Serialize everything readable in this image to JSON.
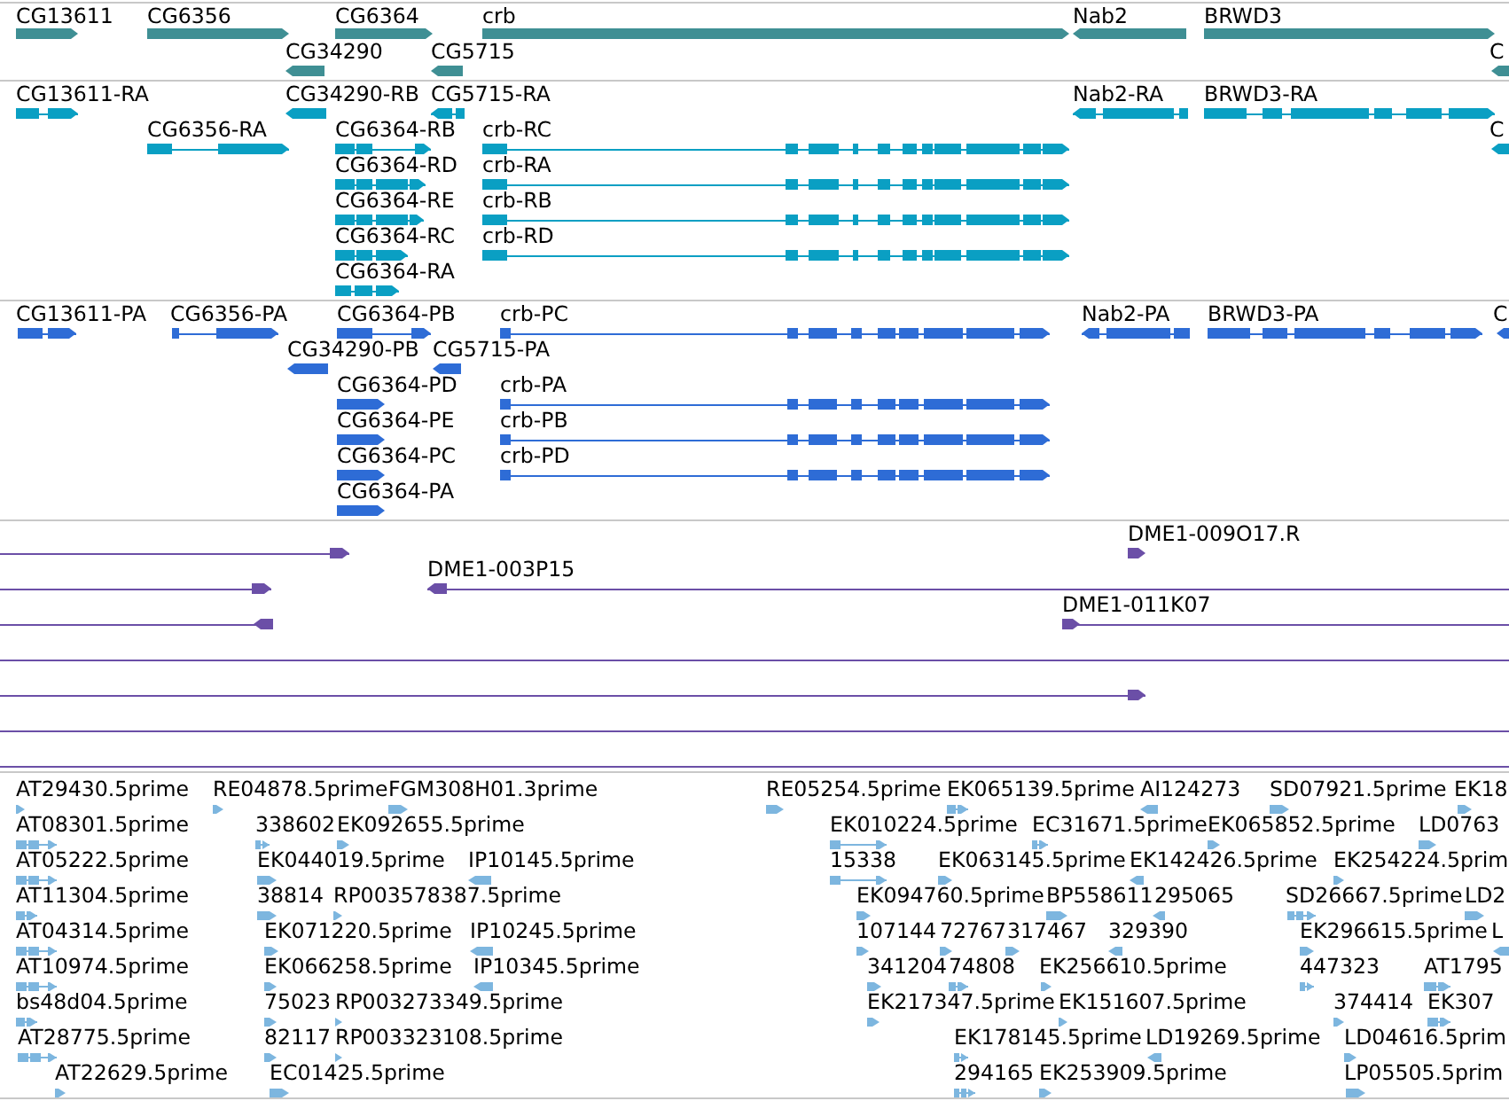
{
  "tracks": [
    {
      "kind": "gene",
      "color": "#3f8f94",
      "features": [
        {
          "label": "CG13611",
          "reverse": false
        },
        {
          "label": "CG6356",
          "reverse": false
        },
        {
          "label": "CG6364",
          "reverse": false
        },
        {
          "label": "crb",
          "reverse": false
        },
        {
          "label": "Nab2",
          "reverse": true
        },
        {
          "label": "BRWD3",
          "reverse": false
        },
        {
          "label": "CG34290",
          "reverse": true
        },
        {
          "label": "CG5715",
          "reverse": true
        },
        {
          "label": "C",
          "reverse": true
        }
      ]
    },
    {
      "kind": "transcript",
      "color": "#0a9fc3",
      "features": [
        {
          "label": "CG13611-RA",
          "reverse": false
        },
        {
          "label": "CG34290-RB",
          "reverse": true
        },
        {
          "label": "CG5715-RA",
          "reverse": true
        },
        {
          "label": "Nab2-RA",
          "reverse": true
        },
        {
          "label": "BRWD3-RA",
          "reverse": false
        },
        {
          "label": "CG6356-RA",
          "reverse": false
        },
        {
          "label": "CG6364-RB",
          "reverse": false
        },
        {
          "label": "crb-RC",
          "reverse": false
        },
        {
          "label": "C",
          "reverse": true
        },
        {
          "label": "CG6364-RD",
          "reverse": false
        },
        {
          "label": "crb-RA",
          "reverse": false
        },
        {
          "label": "CG6364-RE",
          "reverse": false
        },
        {
          "label": "crb-RB",
          "reverse": false
        },
        {
          "label": "CG6364-RC",
          "reverse": false
        },
        {
          "label": "crb-RD",
          "reverse": false
        },
        {
          "label": "CG6364-RA",
          "reverse": false
        }
      ]
    },
    {
      "kind": "protein",
      "color": "#2e6cd6",
      "features": [
        {
          "label": "CG13611-PA",
          "reverse": false
        },
        {
          "label": "CG6356-PA",
          "reverse": false
        },
        {
          "label": "CG6364-PB",
          "reverse": false
        },
        {
          "label": "crb-PC",
          "reverse": false
        },
        {
          "label": "Nab2-PA",
          "reverse": true
        },
        {
          "label": "BRWD3-PA",
          "reverse": false
        },
        {
          "label": "C",
          "reverse": true
        },
        {
          "label": "CG34290-PB",
          "reverse": true
        },
        {
          "label": "CG5715-PA",
          "reverse": true
        },
        {
          "label": "CG6364-PD",
          "reverse": false
        },
        {
          "label": "crb-PA",
          "reverse": false
        },
        {
          "label": "CG6364-PE",
          "reverse": false
        },
        {
          "label": "crb-PB",
          "reverse": false
        },
        {
          "label": "CG6364-PC",
          "reverse": false
        },
        {
          "label": "crb-PD",
          "reverse": false
        },
        {
          "label": "CG6364-PA",
          "reverse": false
        }
      ]
    },
    {
      "kind": "clone",
      "color": "#6b4fa7",
      "features": [
        {
          "kind": "clone",
          "reverse": false
        },
        {
          "kind": "end-read",
          "label": "DME1-009O17.R",
          "reverse": false
        },
        {
          "kind": "clone",
          "reverse": false
        },
        {
          "kind": "clone",
          "label": "DME1-003P15",
          "reverse": true
        },
        {
          "kind": "clone",
          "reverse": true
        },
        {
          "kind": "clone",
          "label": "DME1-011K07",
          "reverse": false
        },
        {
          "kind": "clone"
        },
        {
          "kind": "clone",
          "reverse": false
        },
        {
          "kind": "clone"
        },
        {
          "kind": "clone"
        }
      ]
    },
    {
      "kind": "est",
      "color": "#7db6df",
      "features": [
        {
          "label": "AT29430.5prime",
          "reverse": false
        },
        {
          "label": "RE04878.5prime",
          "reverse": false
        },
        {
          "label": "FGM308H01.3prime",
          "reverse": false
        },
        {
          "label": "RE05254.5prime",
          "reverse": false
        },
        {
          "label": "EK065139.5prime",
          "reverse": false
        },
        {
          "label": "AI124273",
          "reverse": true
        },
        {
          "label": "SD07921.5prime",
          "reverse": false
        },
        {
          "label": "EK18",
          "reverse": false
        },
        {
          "label": "AT08301.5prime",
          "reverse": false
        },
        {
          "label": "338602",
          "reverse": false
        },
        {
          "label": "EK092655.5prime",
          "reverse": false
        },
        {
          "label": "EK010224.5prime",
          "reverse": false
        },
        {
          "label": "EC31671.5prime",
          "reverse": false
        },
        {
          "label": "EK065852.5prime",
          "reverse": false
        },
        {
          "label": "LD0763",
          "reverse": false
        },
        {
          "label": "AT05222.5prime",
          "reverse": false
        },
        {
          "label": "EK044019.5prime",
          "reverse": false
        },
        {
          "label": "IP10145.5prime",
          "reverse": true
        },
        {
          "label": "15338",
          "reverse": false
        },
        {
          "label": "EK063145.5prime",
          "reverse": false
        },
        {
          "label": "EK142426.5prime",
          "reverse": true
        },
        {
          "label": "EK254224.5prim",
          "reverse": false
        },
        {
          "label": "AT11304.5prime",
          "reverse": false
        },
        {
          "label": "38814",
          "reverse": false
        },
        {
          "label": "RP003578387.5prime",
          "reverse": false
        },
        {
          "label": "EK094760.5prime",
          "reverse": false
        },
        {
          "label": "BP558611",
          "reverse": false
        },
        {
          "label": "295065",
          "reverse": true
        },
        {
          "label": "SD26667.5prime",
          "reverse": false
        },
        {
          "label": "LD2",
          "reverse": false
        },
        {
          "label": "AT04314.5prime",
          "reverse": false
        },
        {
          "label": "EK071220.5prime",
          "reverse": false
        },
        {
          "label": "IP10245.5prime",
          "reverse": true
        },
        {
          "label": "107144",
          "reverse": false
        },
        {
          "label": "72767",
          "reverse": false
        },
        {
          "label": "317467",
          "reverse": false
        },
        {
          "label": "329390",
          "reverse": true
        },
        {
          "label": "EK296615.5prime",
          "reverse": false
        },
        {
          "label": "L",
          "reverse": true
        },
        {
          "label": "AT10974.5prime",
          "reverse": false
        },
        {
          "label": "EK066258.5prime",
          "reverse": false
        },
        {
          "label": "IP10345.5prime",
          "reverse": true
        },
        {
          "label": "341204",
          "reverse": false
        },
        {
          "label": "74808",
          "reverse": false
        },
        {
          "label": "EK256610.5prime",
          "reverse": false
        },
        {
          "label": "447323",
          "reverse": false
        },
        {
          "label": "AT1795",
          "reverse": false
        },
        {
          "label": "bs48d04.5prime",
          "reverse": false
        },
        {
          "label": "75023",
          "reverse": false
        },
        {
          "label": "RP003273349.5prime",
          "reverse": false
        },
        {
          "label": "EK217347.5prime",
          "reverse": false
        },
        {
          "label": "EK151607.5prime",
          "reverse": false
        },
        {
          "label": "374414",
          "reverse": false
        },
        {
          "label": "EK307",
          "reverse": false
        },
        {
          "label": "AT28775.5prime",
          "reverse": false
        },
        {
          "label": "82117",
          "reverse": false
        },
        {
          "label": "RP003323108.5prime",
          "reverse": false
        },
        {
          "label": "EK178145.5prime",
          "reverse": false
        },
        {
          "label": "LD19269.5prime",
          "reverse": true
        },
        {
          "label": "LD04616.5prim",
          "reverse": false
        },
        {
          "label": "AT22629.5prime",
          "reverse": false
        },
        {
          "label": "EC01425.5prime",
          "reverse": false
        },
        {
          "label": "294165",
          "reverse": false
        },
        {
          "label": "EK253909.5prime",
          "reverse": false
        },
        {
          "label": "LP05505.5prim",
          "reverse": false
        }
      ]
    }
  ]
}
